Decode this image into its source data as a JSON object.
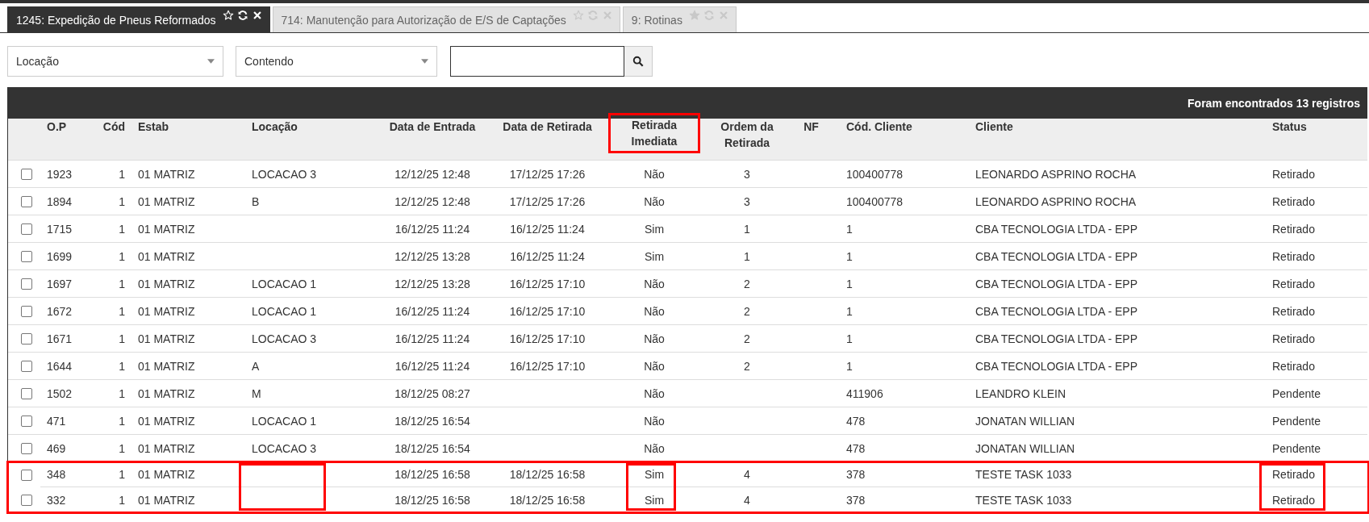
{
  "tabs": [
    {
      "label": "1245: Expedição de Pneus Reformados",
      "selected": true,
      "favorite": false
    },
    {
      "label": "714: Manutenção para Autorização de E/S de Captações",
      "selected": false,
      "favorite": false
    },
    {
      "label": "9: Rotinas",
      "selected": false,
      "favorite": true
    }
  ],
  "filters": {
    "field": "Locação",
    "operator": "Contendo"
  },
  "table": {
    "summary": "Foram encontrados 13 registros",
    "columns": [
      {
        "label": "O.P",
        "marked": false,
        "row_box": false
      },
      {
        "label": "Cód",
        "marked": false,
        "row_box": false
      },
      {
        "label": "Estab",
        "marked": false,
        "row_box": false
      },
      {
        "label": "Locação",
        "marked": false,
        "row_box": true
      },
      {
        "label": "Data de Entrada",
        "marked": false,
        "row_box": false
      },
      {
        "label": "Data de Retirada",
        "marked": false,
        "row_box": false
      },
      {
        "label": "Retirada Imediata",
        "marked": true,
        "row_box": true
      },
      {
        "label": "Ordem da Retirada",
        "marked": false,
        "row_box": false
      },
      {
        "label": "NF",
        "marked": false,
        "row_box": false
      },
      {
        "label": "Cód. Cliente",
        "marked": false,
        "row_box": false
      },
      {
        "label": "Cliente",
        "marked": false,
        "row_box": false
      },
      {
        "label": "Status",
        "marked": false,
        "row_box": true
      }
    ],
    "rows": [
      {
        "checked": false,
        "marked": false,
        "cells": [
          "1923",
          "1",
          "01 MATRIZ",
          "LOCACAO 3",
          "12/12/25 12:48",
          "17/12/25 17:26",
          "Não",
          "3",
          "",
          "100400778",
          "LEONARDO ASPRINO ROCHA",
          "Retirado"
        ]
      },
      {
        "checked": false,
        "marked": false,
        "cells": [
          "1894",
          "1",
          "01 MATRIZ",
          "B",
          "12/12/25 12:48",
          "17/12/25 17:26",
          "Não",
          "3",
          "",
          "100400778",
          "LEONARDO ASPRINO ROCHA",
          "Retirado"
        ]
      },
      {
        "checked": false,
        "marked": false,
        "cells": [
          "1715",
          "1",
          "01 MATRIZ",
          "",
          "16/12/25 11:24",
          "16/12/25 11:24",
          "Sim",
          "1",
          "",
          "1",
          "CBA TECNOLOGIA LTDA - EPP",
          "Retirado"
        ]
      },
      {
        "checked": false,
        "marked": false,
        "cells": [
          "1699",
          "1",
          "01 MATRIZ",
          "",
          "12/12/25 13:28",
          "16/12/25 11:24",
          "Sim",
          "1",
          "",
          "1",
          "CBA TECNOLOGIA LTDA - EPP",
          "Retirado"
        ]
      },
      {
        "checked": false,
        "marked": false,
        "cells": [
          "1697",
          "1",
          "01 MATRIZ",
          "LOCACAO 1",
          "12/12/25 13:28",
          "16/12/25 17:10",
          "Não",
          "2",
          "",
          "1",
          "CBA TECNOLOGIA LTDA - EPP",
          "Retirado"
        ]
      },
      {
        "checked": false,
        "marked": false,
        "cells": [
          "1672",
          "1",
          "01 MATRIZ",
          "LOCACAO 1",
          "16/12/25 11:24",
          "16/12/25 17:10",
          "Não",
          "2",
          "",
          "1",
          "CBA TECNOLOGIA LTDA - EPP",
          "Retirado"
        ]
      },
      {
        "checked": false,
        "marked": false,
        "cells": [
          "1671",
          "1",
          "01 MATRIZ",
          "LOCACAO 3",
          "16/12/25 11:24",
          "16/12/25 17:10",
          "Não",
          "2",
          "",
          "1",
          "CBA TECNOLOGIA LTDA - EPP",
          "Retirado"
        ]
      },
      {
        "checked": false,
        "marked": false,
        "cells": [
          "1644",
          "1",
          "01 MATRIZ",
          "A",
          "16/12/25 11:24",
          "16/12/25 17:10",
          "Não",
          "2",
          "",
          "1",
          "CBA TECNOLOGIA LTDA - EPP",
          "Retirado"
        ]
      },
      {
        "checked": false,
        "marked": false,
        "cells": [
          "1502",
          "1",
          "01 MATRIZ",
          "M",
          "18/12/25 08:27",
          "",
          "Não",
          "",
          "",
          "411906",
          "LEANDRO KLEIN",
          "Pendente"
        ]
      },
      {
        "checked": false,
        "marked": false,
        "cells": [
          "471",
          "1",
          "01 MATRIZ",
          "LOCACAO 1",
          "18/12/25 16:54",
          "",
          "Não",
          "",
          "",
          "478",
          "JONATAN WILLIAN",
          "Pendente"
        ]
      },
      {
        "checked": false,
        "marked": false,
        "cells": [
          "469",
          "1",
          "01 MATRIZ",
          "LOCACAO 3",
          "18/12/25 16:54",
          "",
          "Não",
          "",
          "",
          "478",
          "JONATAN WILLIAN",
          "Pendente"
        ]
      },
      {
        "checked": false,
        "marked": true,
        "cells": [
          "348",
          "1",
          "01 MATRIZ",
          "",
          "18/12/25 16:58",
          "18/12/25 16:58",
          "Sim",
          "4",
          "",
          "378",
          "TESTE TASK 1033",
          "Retirado"
        ]
      },
      {
        "checked": false,
        "marked": true,
        "cells": [
          "332",
          "1",
          "01 MATRIZ",
          "",
          "18/12/25 16:58",
          "18/12/25 16:58",
          "Sim",
          "4",
          "",
          "378",
          "TESTE TASK 1033",
          "Retirado"
        ]
      }
    ]
  }
}
